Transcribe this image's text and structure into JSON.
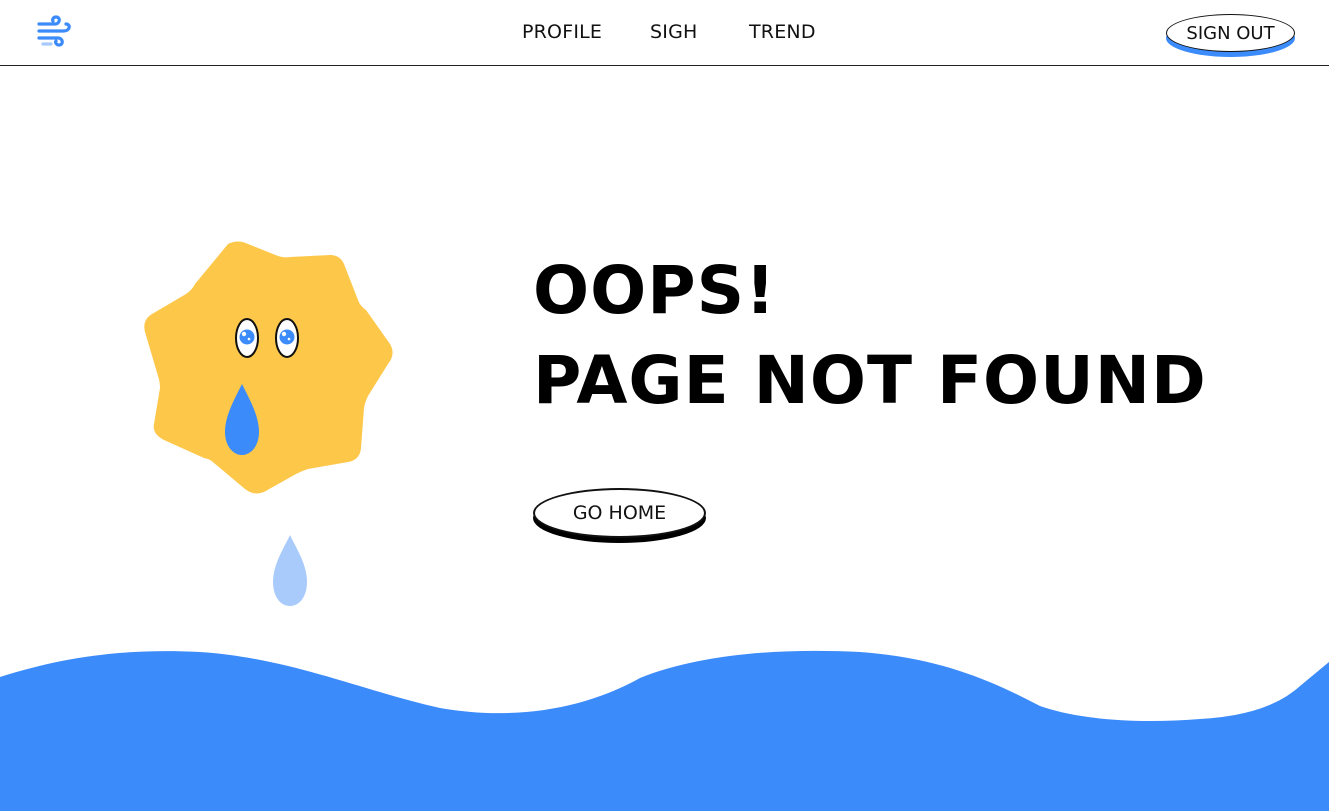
{
  "nav": {
    "logo_icon": "wind-icon",
    "items": [
      {
        "label": "PROFILE"
      },
      {
        "label": "SIGH"
      },
      {
        "label": "TREND"
      }
    ],
    "sign_out_label": "SIGN OUT"
  },
  "main": {
    "headline_line1": "OOPS!",
    "headline_line2": "PAGE NOT FOUND",
    "go_home_label": "GO HOME",
    "illustration": "crying-sun-icon"
  },
  "colors": {
    "accent_blue": "#3c8bfa",
    "light_blue": "#a9cbfb",
    "sun_yellow": "#fdc84a",
    "text": "#000000",
    "background": "#ffffff"
  }
}
